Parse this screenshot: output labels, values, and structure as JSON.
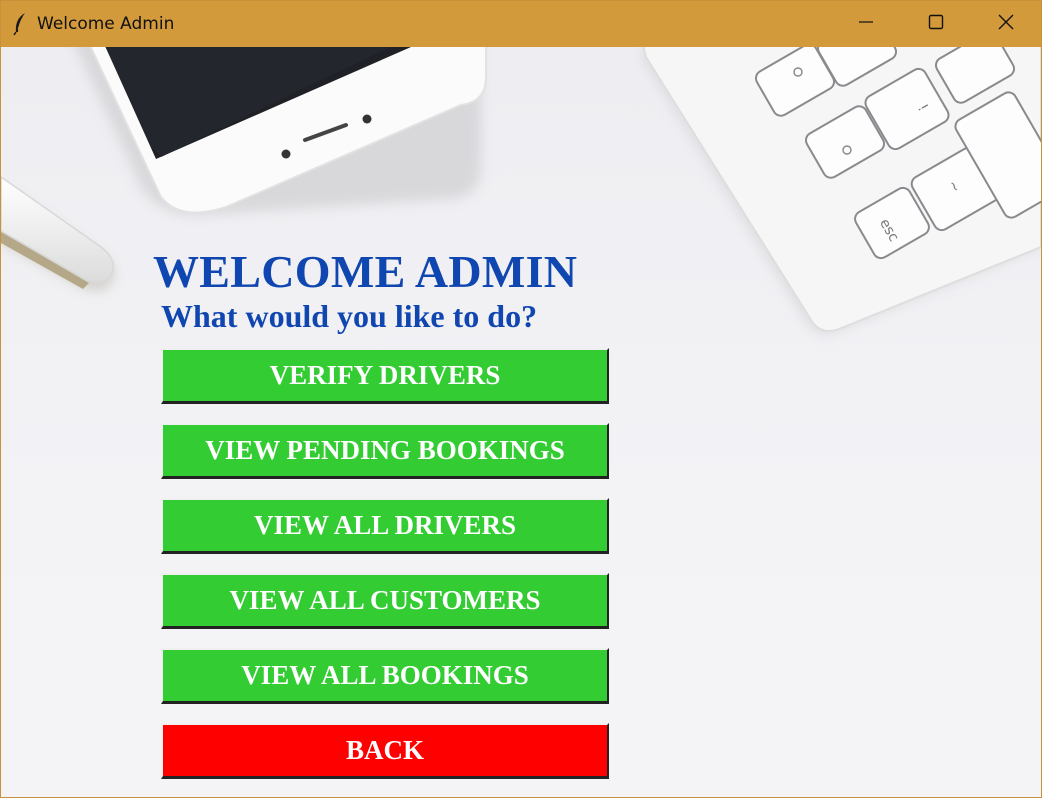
{
  "window": {
    "title": "Welcome Admin",
    "app_icon": "feather-icon",
    "controls": [
      "minimize-icon",
      "maximize-icon",
      "close-icon"
    ]
  },
  "colors": {
    "titlebar": "#d39a3c",
    "heading": "#1046b0",
    "primary_button": "#33cc33",
    "back_button": "#ff0000",
    "button_text": "#ffffff"
  },
  "main": {
    "title": "WELCOME ADMIN",
    "subtitle": "What would you like to do?",
    "buttons": [
      {
        "label": "VERIFY DRIVERS",
        "color": "#33cc33"
      },
      {
        "label": "VIEW PENDING BOOKINGS",
        "color": "#33cc33"
      },
      {
        "label": "VIEW ALL DRIVERS",
        "color": "#33cc33"
      },
      {
        "label": "VIEW ALL CUSTOMERS",
        "color": "#33cc33"
      },
      {
        "label": "VIEW ALL BOOKINGS",
        "color": "#33cc33"
      },
      {
        "label": "BACK",
        "color": "#ff0000"
      }
    ]
  },
  "background": {
    "key_labels": [
      "esc",
      "~",
      "!"
    ]
  }
}
